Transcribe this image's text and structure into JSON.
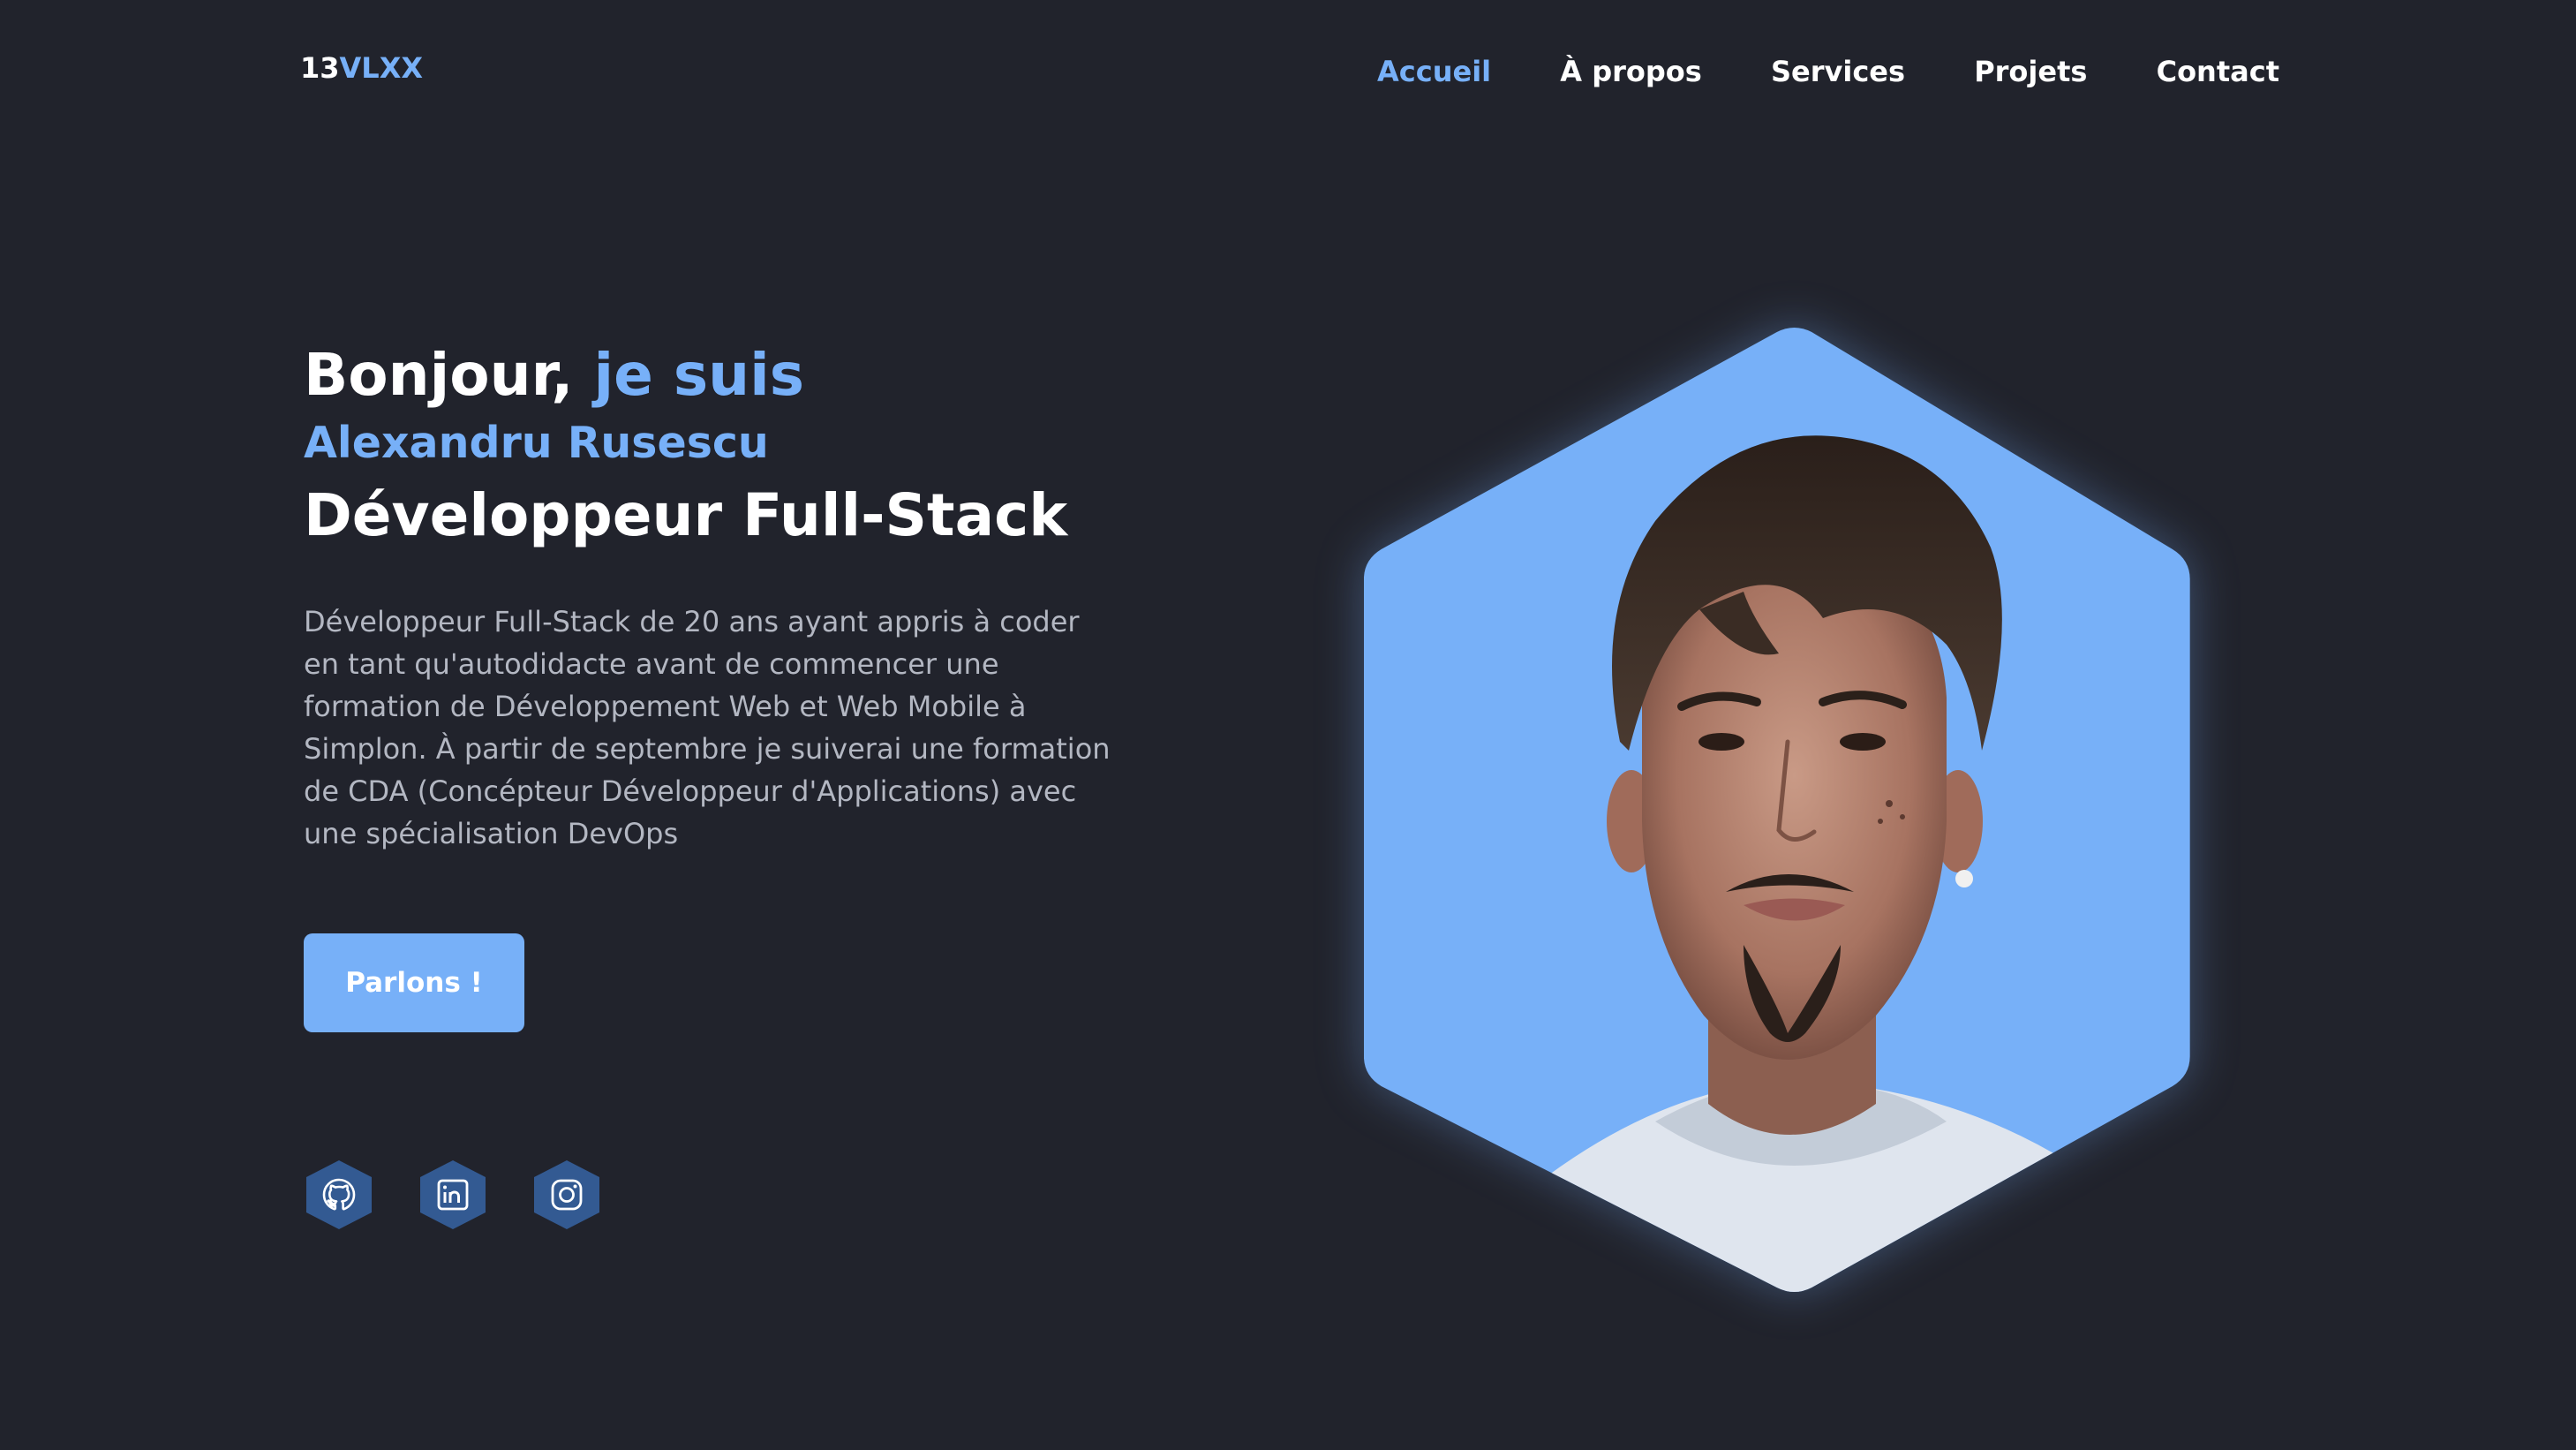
{
  "header": {
    "logo_prefix": "13",
    "logo_accent": "VLXX",
    "nav": [
      {
        "label": "Accueil",
        "active": true
      },
      {
        "label": "À propos",
        "active": false
      },
      {
        "label": "Services",
        "active": false
      },
      {
        "label": "Projets",
        "active": false
      },
      {
        "label": "Contact",
        "active": false
      }
    ]
  },
  "hero": {
    "greeting": "Bonjour,",
    "greeting_accent": "je suis",
    "name": "Alexandru Rusescu",
    "role": "Développeur Full-Stack",
    "description": "Développeur Full-Stack de 20 ans ayant appris à coder en tant qu'autodidacte avant de commencer une formation de Développement Web et Web Mobile à Simplon. À partir de septembre je suiverai une formation de CDA (Concépteur Développeur d'Applications) avec une spécialisation DevOps",
    "cta_label": "Parlons !"
  },
  "socials": [
    {
      "icon": "github-icon"
    },
    {
      "icon": "linkedin-icon"
    },
    {
      "icon": "instagram-icon"
    }
  ],
  "colors": {
    "background": "#21232c",
    "accent": "#77b0f8",
    "text": "#ffffff",
    "muted_text": "#b3b7c2",
    "social_bg": "#335a92"
  }
}
